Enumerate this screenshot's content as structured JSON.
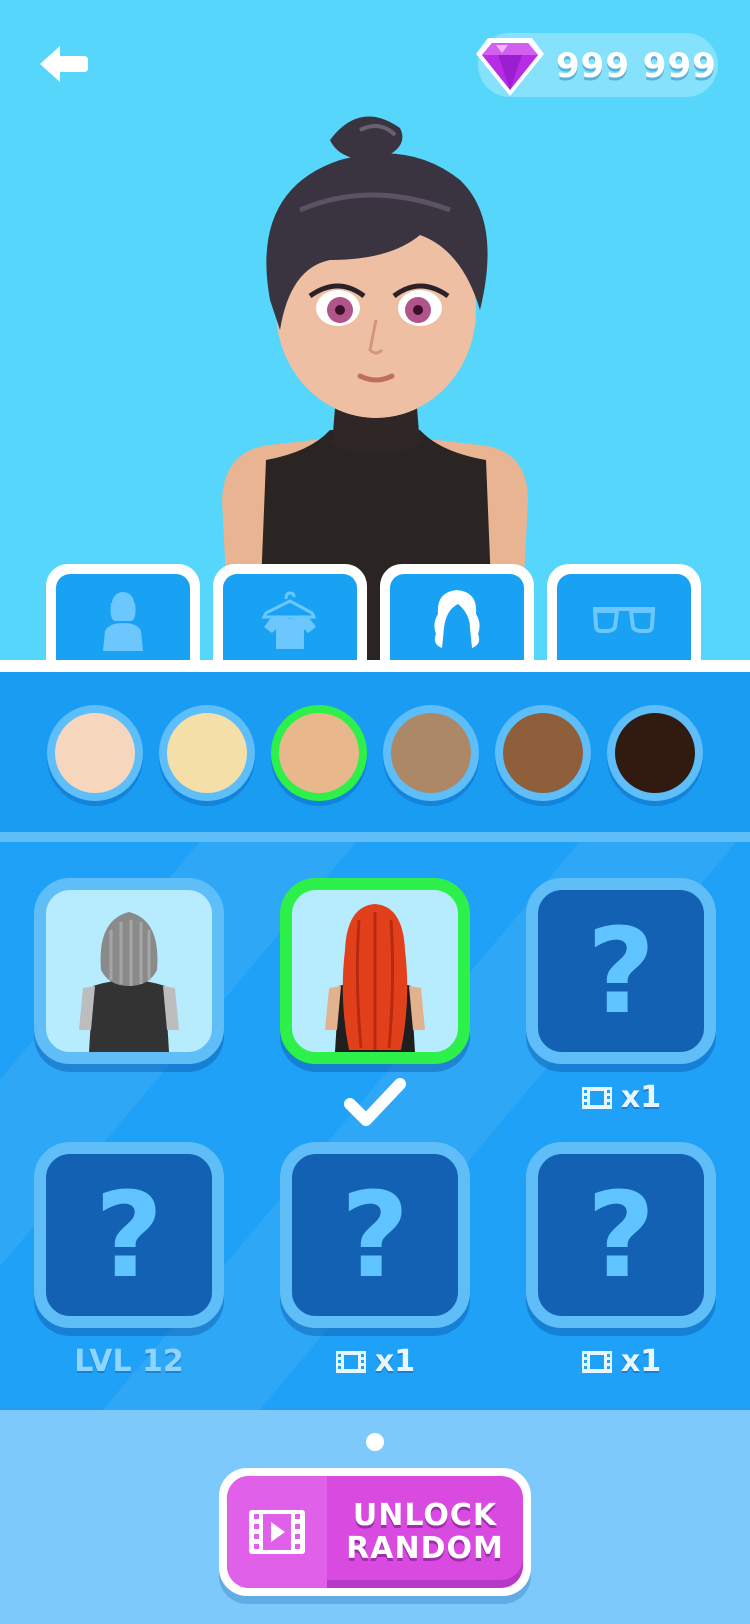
{
  "currency": {
    "icon": "gem-icon",
    "amount": "999 999",
    "color": "#b72de6"
  },
  "tabs": [
    {
      "name": "body",
      "icon": "person-icon"
    },
    {
      "name": "outfit",
      "icon": "shirt-icon"
    },
    {
      "name": "hair",
      "icon": "hair-icon",
      "active": true
    },
    {
      "name": "glasses",
      "icon": "glasses-icon"
    }
  ],
  "skin_tones": [
    "#f6d7bd",
    "#f5dfa9",
    "#e8b88c",
    "#ad8866",
    "#8f5f3b",
    "#311b10"
  ],
  "skin_tone_selected_index": 2,
  "hair_items": [
    {
      "state": "owned",
      "color": "gray",
      "caption": ""
    },
    {
      "state": "selected",
      "color": "red",
      "caption": ""
    },
    {
      "state": "locked",
      "caption": "x1",
      "caption_icon": "film-icon"
    },
    {
      "state": "locked",
      "caption": "LVL 12"
    },
    {
      "state": "locked",
      "caption": "x1",
      "caption_icon": "film-icon"
    },
    {
      "state": "locked",
      "caption": "x1",
      "caption_icon": "film-icon"
    }
  ],
  "lock_symbol": "?",
  "unlock_button": {
    "label": "UNLOCK\nRANDOM",
    "icon": "video-icon"
  },
  "colors": {
    "background": "#57d6fb",
    "panel": "#1ea1f6",
    "accent_green": "#2ef04a",
    "button_magenta": "#d94ae0"
  }
}
